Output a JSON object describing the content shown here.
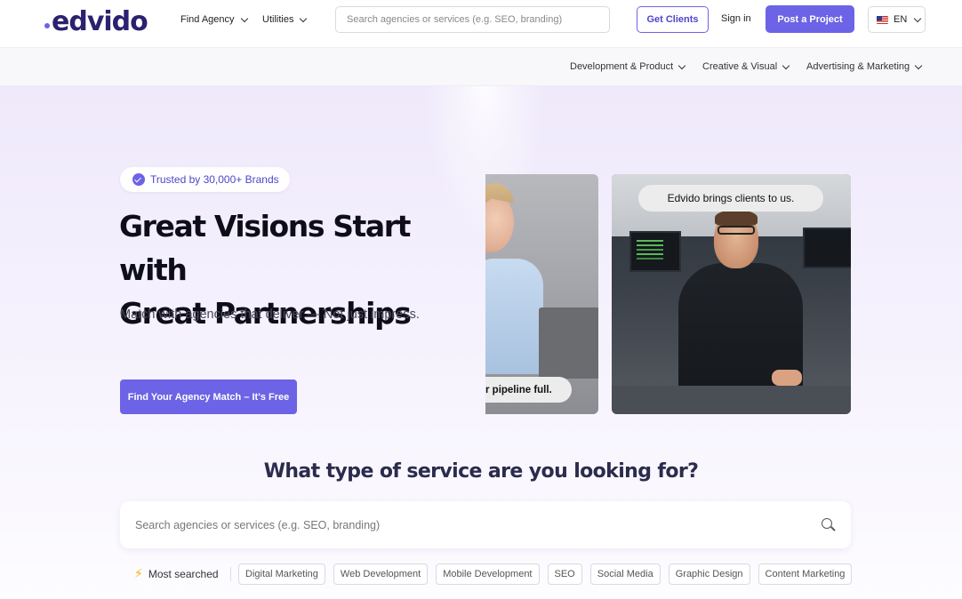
{
  "brand": {
    "logo_text": "edvido"
  },
  "header": {
    "nav": [
      {
        "label": "Find Agency"
      },
      {
        "label": "Utilities"
      }
    ],
    "search_placeholder": "Search agencies or services (e.g. SEO, branding)",
    "get_clients": "Get Clients",
    "sign_in": "Sign in",
    "post_project": "Post a Project",
    "language": "EN"
  },
  "subnav": [
    {
      "label": "Development & Product"
    },
    {
      "label": "Creative & Visual"
    },
    {
      "label": "Advertising & Marketing"
    }
  ],
  "hero": {
    "trust_badge": "Trusted by 30,000+ Brands",
    "title_line1": "Great Visions Start with",
    "title_line2": "Great Partnerships",
    "subtitle": "Match with agencies that deliver — Not just impress.",
    "cta": "Find Your Agency Match – It's Free",
    "card1_caption": "r pipeline full.",
    "card2_caption": "Edvido brings clients to us."
  },
  "service_search": {
    "title": "What type of service are you looking for?",
    "placeholder": "Search agencies or services (e.g. SEO, branding)",
    "most_searched_label": "Most searched",
    "tags": [
      "Digital Marketing",
      "Web Development",
      "Mobile Development",
      "SEO",
      "Social Media",
      "Graphic Design",
      "Content Marketing"
    ]
  },
  "colors": {
    "accent": "#6c63e6",
    "brand_dark": "#2b2170",
    "hero_bg": "#efe9fb"
  },
  "icons": {
    "verified": "verified-badge-icon",
    "search": "search-icon",
    "bolt": "lightning-bolt-icon",
    "chevron": "chevron-down-icon",
    "flag": "us-flag-icon"
  }
}
